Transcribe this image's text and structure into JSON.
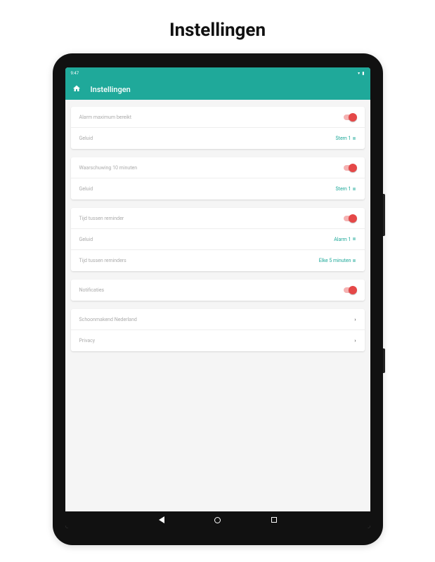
{
  "page_heading": "Instellingen",
  "statusbar": {
    "time": "9:47"
  },
  "appbar": {
    "title": "Instellingen"
  },
  "groups": [
    {
      "rows": [
        {
          "label": "Alarm maximum bereikt",
          "type": "toggle"
        },
        {
          "label": "Geluid",
          "type": "value",
          "value": "Stem 1"
        }
      ]
    },
    {
      "rows": [
        {
          "label": "Waarschuwing 10 minuten",
          "type": "toggle"
        },
        {
          "label": "Geluid",
          "type": "value",
          "value": "Stem 1"
        }
      ]
    },
    {
      "rows": [
        {
          "label": "Tijd tussen reminder",
          "type": "toggle"
        },
        {
          "label": "Geluid",
          "type": "value",
          "value": "Alarm 1"
        },
        {
          "label": "Tijd tussen reminders",
          "type": "value",
          "value": "Elke 5 minuten"
        }
      ]
    },
    {
      "rows": [
        {
          "label": "Notificaties",
          "type": "toggle"
        }
      ]
    },
    {
      "rows": [
        {
          "label": "Schoonmakend Nederland",
          "type": "link"
        },
        {
          "label": "Privacy",
          "type": "link"
        }
      ]
    }
  ]
}
